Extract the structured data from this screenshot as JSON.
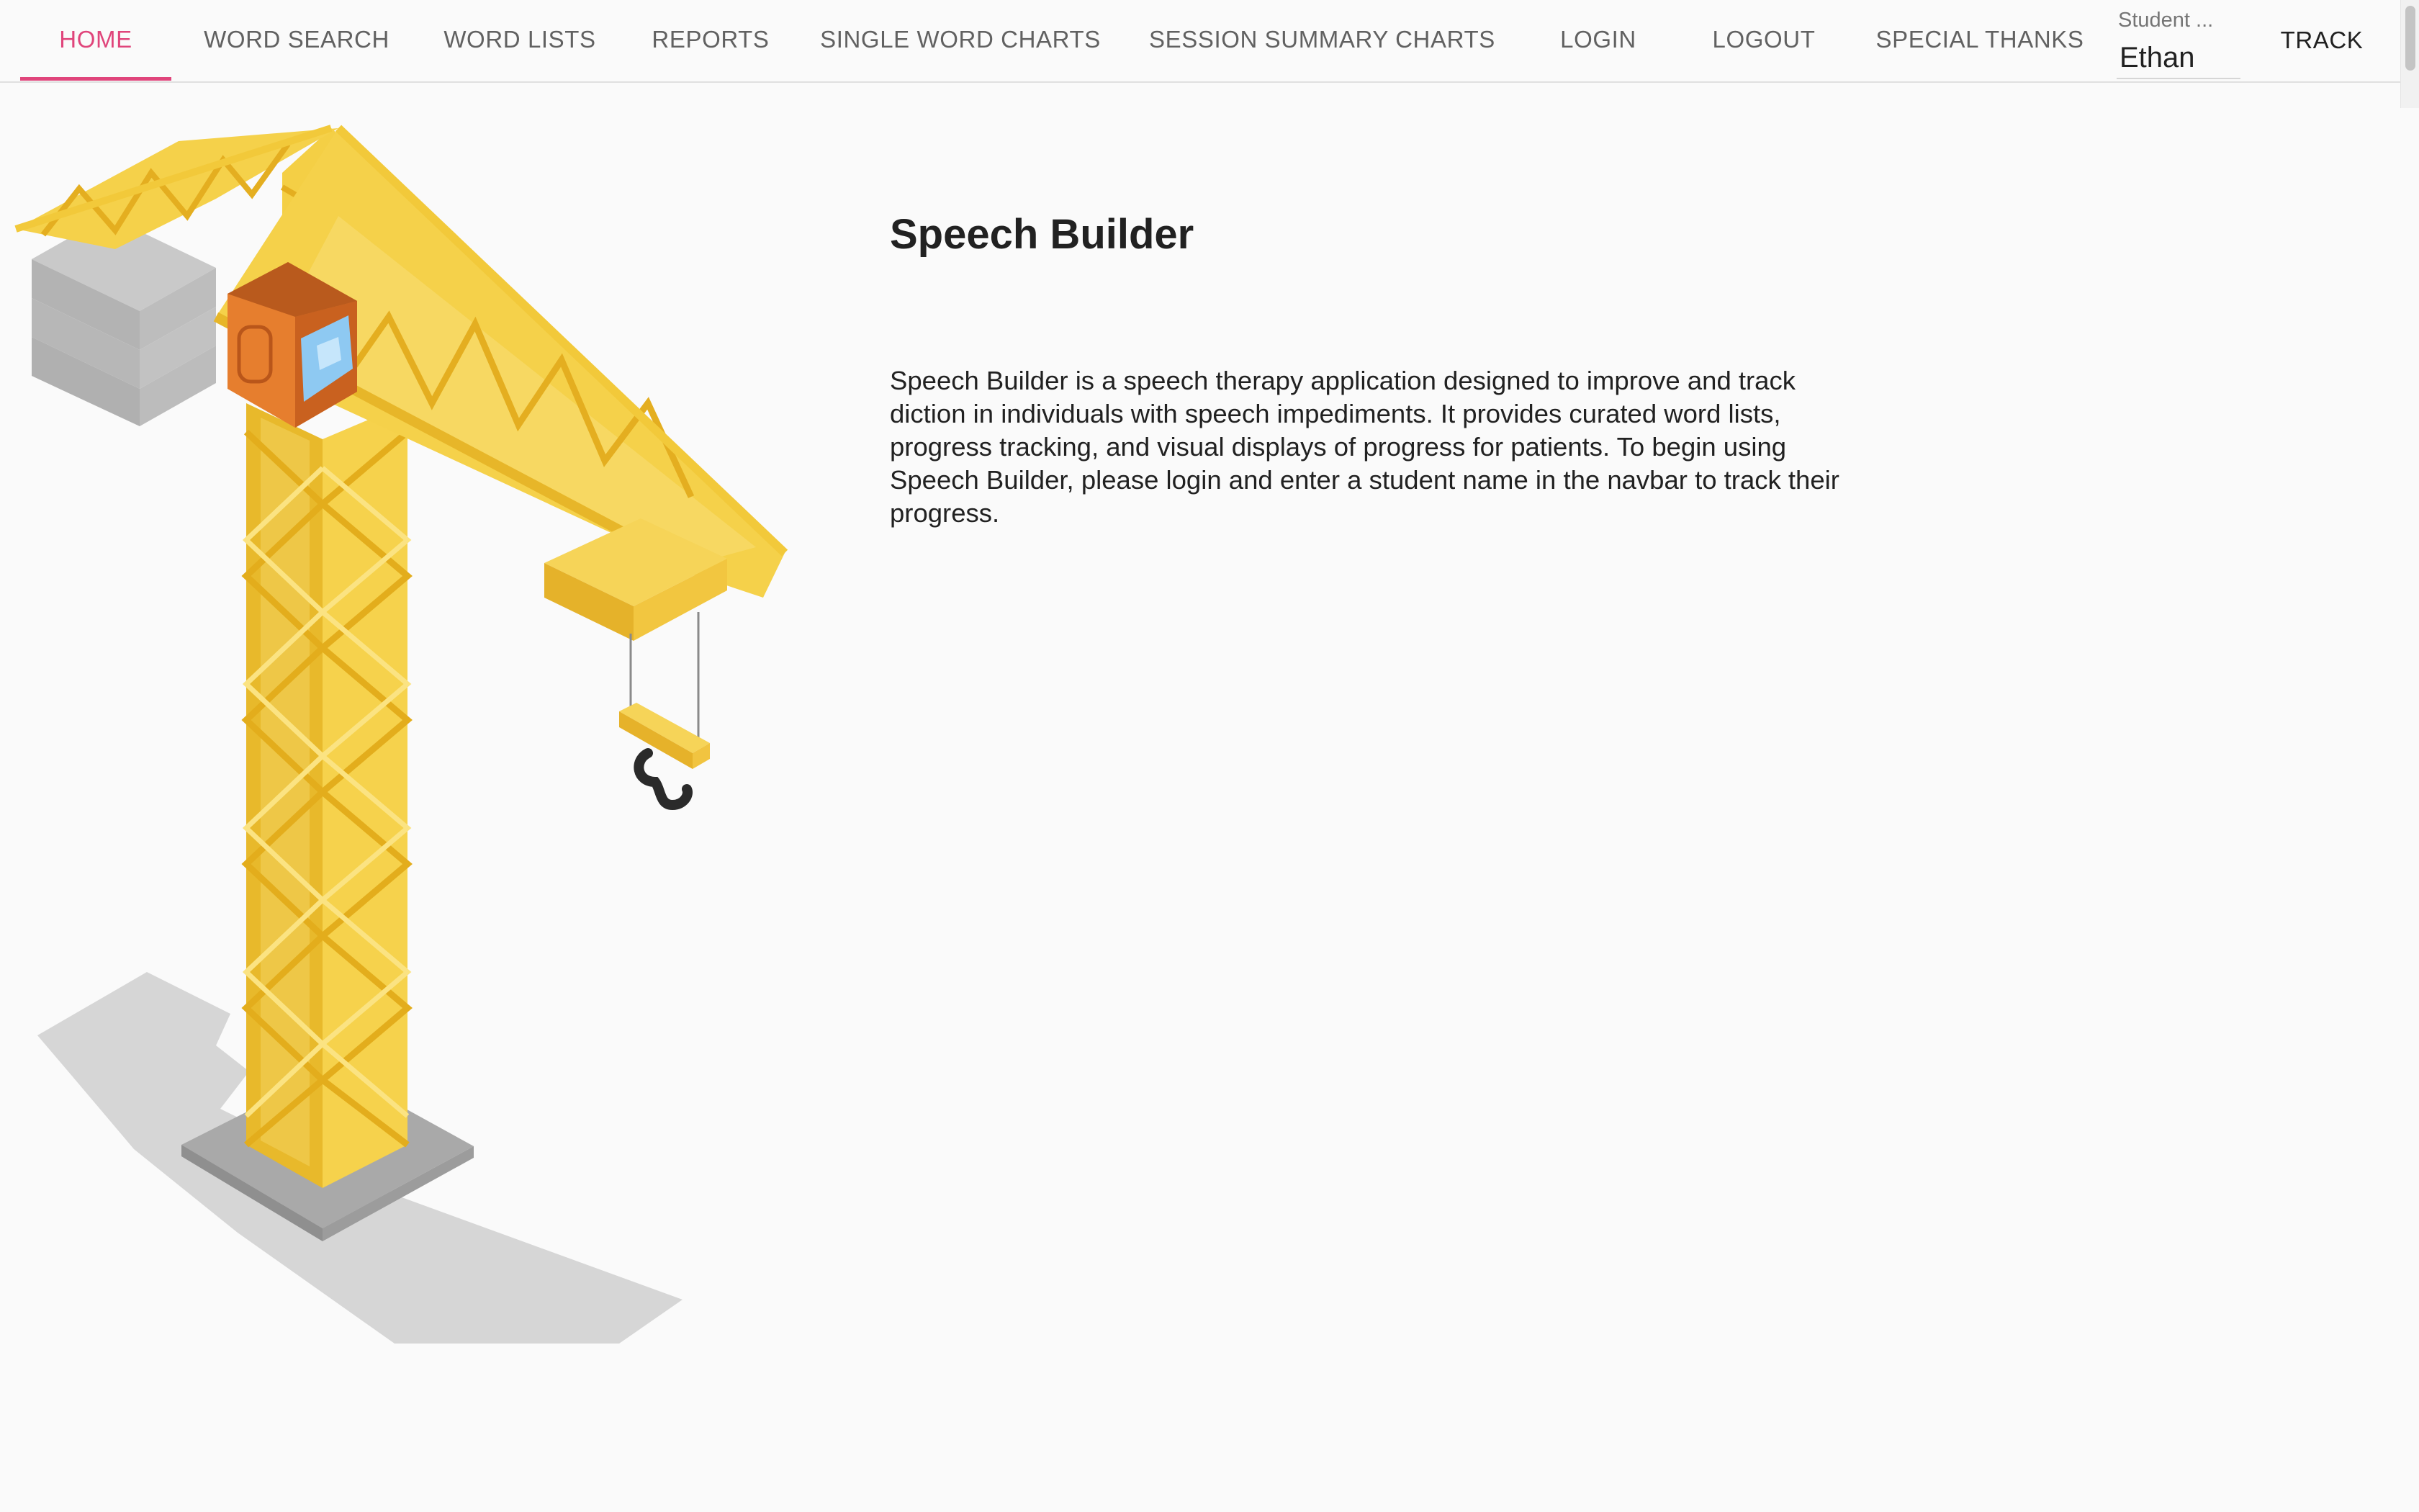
{
  "navbar": {
    "tabs": [
      {
        "label": "HOME",
        "active": true
      },
      {
        "label": "WORD SEARCH"
      },
      {
        "label": "WORD LISTS"
      },
      {
        "label": "REPORTS"
      },
      {
        "label": "SINGLE WORD CHARTS"
      },
      {
        "label": "SESSION SUMMARY CHARTS"
      },
      {
        "label": "LOGIN"
      },
      {
        "label": "LOGOUT"
      },
      {
        "label": "SPECIAL THANKS"
      }
    ],
    "student_field": {
      "label": "Student ...",
      "value": "Ethan"
    },
    "track_label": "TRACK"
  },
  "main": {
    "title": "Speech Builder",
    "description": "Speech Builder is a speech therapy application designed to improve and track diction in individuals with speech impediments. It provides curated word lists, progress tracking, and visual displays of progress for patients. To begin using Speech Builder, please login and enter a student name in the navbar to track their progress."
  },
  "colors": {
    "accent": "#e0457b",
    "background": "#fafafa",
    "crane_yellow": "#f5cc3a",
    "cab_orange": "#e07a2b"
  }
}
